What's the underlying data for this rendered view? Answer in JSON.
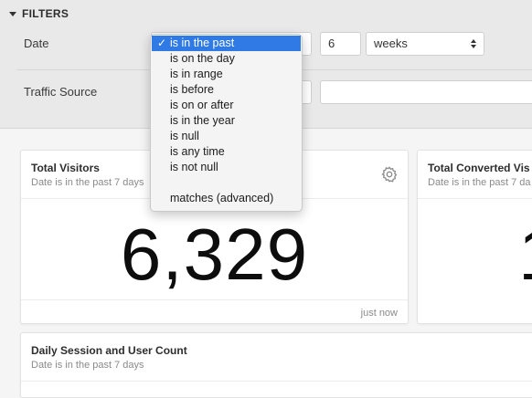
{
  "filters": {
    "heading": "FILTERS",
    "date": {
      "label": "Date",
      "amount": "6",
      "unit": "weeks"
    },
    "traffic_source": {
      "label": "Traffic Source"
    }
  },
  "dropdown": {
    "selected": "is in the past",
    "check": "✓",
    "items": [
      "is on the day",
      "is in range",
      "is before",
      "is on or after",
      "is in the year",
      "is null",
      "is any time",
      "is not null"
    ],
    "advanced": "matches (advanced)"
  },
  "tiles": {
    "total_visitors": {
      "title": "Total Visitors",
      "subtitle": "Date is in the past 7 days",
      "value": "6,329",
      "footer": "just now"
    },
    "total_converted": {
      "title": "Total Converted Vis",
      "subtitle": "Date is in the past 7 da",
      "value": "1"
    },
    "daily_session": {
      "title": "Daily Session and User Count",
      "subtitle": "Date is in the past 7 days"
    }
  },
  "icons": {
    "settings": "gear-icon",
    "collapse": "caret-down-icon"
  }
}
